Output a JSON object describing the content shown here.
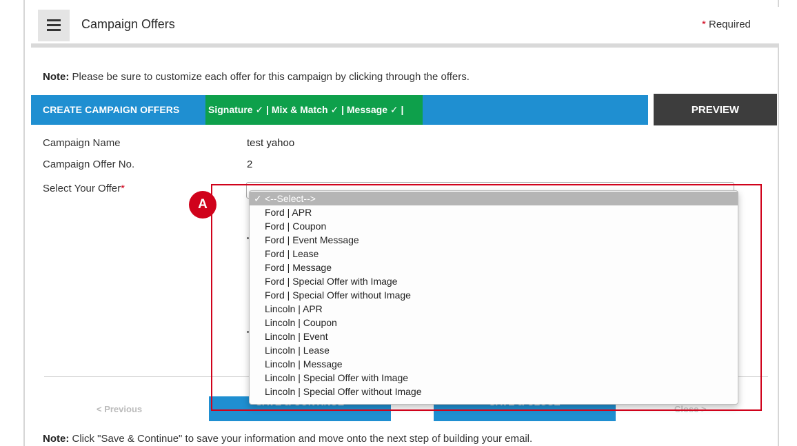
{
  "header": {
    "title": "Campaign Offers",
    "required_star": "*",
    "required_label": " Required"
  },
  "note": {
    "label": "Note:",
    "text": " Please be sure to customize each offer for this campaign by clicking through the offers."
  },
  "tabs": {
    "create_label": "CREATE CAMPAIGN OFFERS",
    "status_text": "Signature ✓ | Mix & Match ✓ | Message ✓ |",
    "preview_label": "PREVIEW"
  },
  "form": {
    "campaign_name_label": "Campaign Name",
    "campaign_name_value": "test yahoo",
    "offer_no_label": "Campaign Offer No.",
    "offer_no_value": "2",
    "select_offer_label": "Select Your Offer",
    "select_offer_star": "*"
  },
  "dropdown": {
    "selected_check": "✓",
    "options": [
      "<--Select-->",
      "Ford | APR",
      "Ford | Coupon",
      "Ford | Event Message",
      "Ford | Lease",
      "Ford | Message",
      "Ford | Special Offer with Image",
      "Ford | Special Offer without Image",
      "Lincoln | APR",
      "Lincoln | Coupon",
      "Lincoln | Event",
      "Lincoln | Lease",
      "Lincoln | Message",
      "Lincoln | Special Offer with Image",
      "Lincoln | Special Offer without Image"
    ]
  },
  "annotation": {
    "badge": "A",
    "color": "#d0021b"
  },
  "footer": {
    "previous_label": "< Previous",
    "save_continue_label": "SAVE & CONTINUE",
    "save_close_label": "SAVE & CLOSE",
    "close_label": "Close >"
  },
  "bottom_note": {
    "label": "Note:",
    "text": " Click \"Save & Continue\" to save your information and move onto the next step of building your email."
  },
  "colors": {
    "accent_blue": "#1f8fd1",
    "success_green": "#0ea04b",
    "preview_dark": "#3d3d3d",
    "required_red": "#d0021b"
  }
}
